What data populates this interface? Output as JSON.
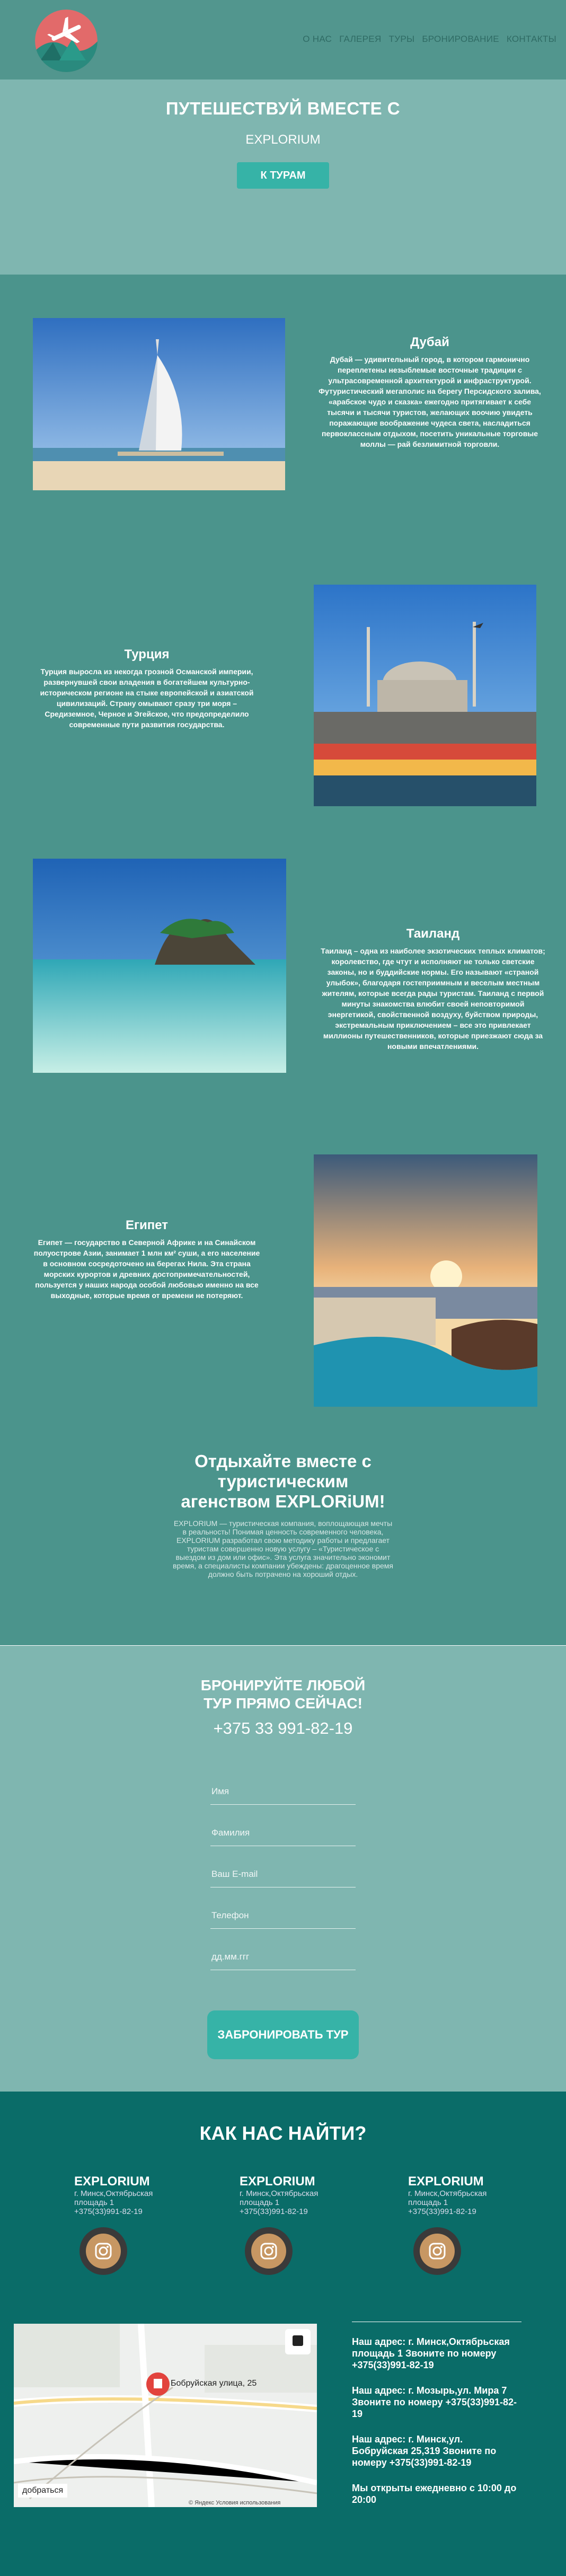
{
  "header": {
    "nav": [
      "О НАС",
      "ГАЛЕРЕЯ",
      "ТУРЫ",
      "БРОНИРОВАНИЕ",
      "КОНТАКТЫ"
    ]
  },
  "hero": {
    "title": "ПУТЕШЕСТВУЙ ВМЕСТЕ С",
    "subtitle": "EXPLORIUM",
    "button": "К ТУРАМ"
  },
  "destinations": [
    {
      "title": "Дубай",
      "text": "Дубай — удивительный город, в котором гармонично переплетены незыблемые восточные традиции с ультрасовременной архитектурой и инфраструктурой. Футуристический мегаполис на берегу Персидского залива, «арабское чудо и сказка» ежегодно притягивает к себе тысячи и тысячи туристов, желающих воочию увидеть поражающие воображение чудеса света, насладиться первоклассным отдыхом, посетить уникальные торговые моллы — рай безлимитной торговли."
    },
    {
      "title": "Турция",
      "text": "Турция выросла из некогда грозной Османской империи, развернувшей свои владения в богатейшем культурно-историческом регионе на стыке европейской и азиатской цивилизаций. Страну омывают сразу три моря – Средиземное, Черное и Эгейское, что предопределило современные пути развития государства."
    },
    {
      "title": "Таиланд",
      "text": "Таиланд – одна из наиболее экзотических теплых климатов; королевство, где чтут и исполняют не только светские законы, но и буддийские нормы. Его называют «страной улыбок», благодаря гостеприимным и веселым местным жителям, которые всегда рады туристам. Таиланд с первой минуты знакомства влюбит своей неповторимой энергетикой, свойственной воздуху, буйством природы, экстремальным приключением – все это привлекает миллионы путешественников, которые приезжают сюда за новыми впечатлениями."
    },
    {
      "title": "Египет",
      "text": "Египет — государство в Северной Африке и на Синайском полуострове Азии, занимает 1 млн км² суши, а его население в основном сосредоточено на берегах Нила. Эта страна морских курортов и древних достопримечательностей, пользуется у наших народа особой любовью именно на все выходные, которые время от времени не потеряют."
    }
  ],
  "about": {
    "title": "Отдыхайте вместе с туристическим агенством EXPLORiUM!",
    "text": "EXPLORIUM — туристическая компания, воплощающая мечты в реальность! Понимая ценность современного человека, EXPLORIUM разработал свою методику работы и предлагает туристам совершенно новую услугу – «Туристическое с выездом из дом или офис». Эта услуга значительно экономит время, а специалисты компании убеждены: драгоценное время должно быть потрачено на хороший отдых."
  },
  "booking": {
    "title": "БРОНИРУЙТЕ ЛЮБОЙ ТУР ПРЯМО СЕЙЧАС!",
    "phone": "+375 33 991-82-19",
    "fields": [
      "Имя",
      "Фамилия",
      "Ваш  E-mail",
      "Телефон",
      "дд.мм.ггг"
    ],
    "button": "ЗАБРОНИРОВАТЬ ТУР"
  },
  "contacts": {
    "title": "КАК НАС НАЙТИ?",
    "offices": [
      {
        "name": "EXPLORIUM",
        "address": "г. Минск,Октябрьская площадь 1",
        "phone": "+375(33)991-82-19"
      },
      {
        "name": "EXPLORIUM",
        "address": "г. Минск,Октябрьская площадь 1",
        "phone": "+375(33)991-82-19"
      },
      {
        "name": "EXPLORIUM",
        "address": "г. Минск,Октябрьская площадь 1",
        "phone": "+375(33)991-82-19"
      }
    ],
    "map": {
      "pin_label": "Бобруйская улица, 25",
      "link": "добраться",
      "footer": "© Яндекс  Условия использования"
    },
    "info": [
      "Наш адрес: г. Минск,Октябрьская площадь 1 Звоните по номеру +375(33)991-82-19",
      "Наш адрес: г. Мозырь,ул. Мира 7 Звоните по номеру +375(33)991-82-19",
      "Наш адрес: г. Минск,ул. Бобруйская 25,319 Звоните по номеру +375(33)991-82-19",
      "Мы открыты ежедневно с 10:00 до 20:00"
    ]
  },
  "colors": {
    "header": "#52968e",
    "hero": "#7fb6b0",
    "accent": "#36b3a7",
    "contacts": "#0a6c68"
  }
}
